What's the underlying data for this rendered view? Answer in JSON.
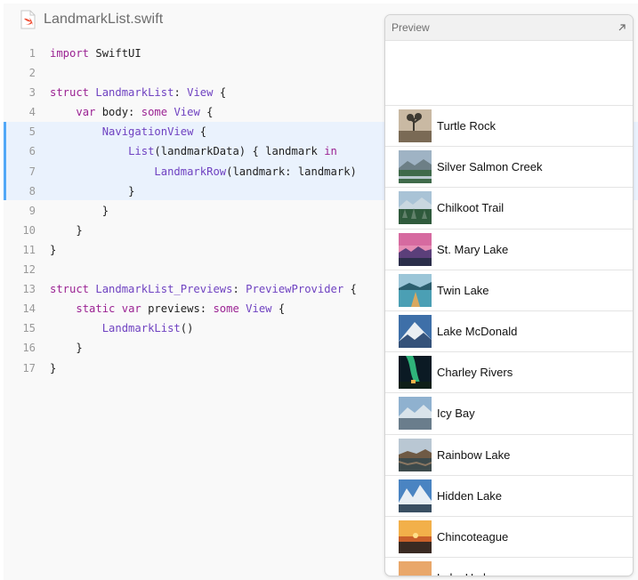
{
  "file": {
    "title": "LandmarkList.swift",
    "icon": "swift-file-icon"
  },
  "code": {
    "highlighted_lines": [
      5,
      6,
      7,
      8
    ],
    "lines": [
      {
        "n": "1",
        "indent": 0,
        "tokens": [
          {
            "t": "kw",
            "v": "import"
          },
          {
            "t": "tx",
            "v": " SwiftUI"
          }
        ]
      },
      {
        "n": "2",
        "indent": 0,
        "tokens": []
      },
      {
        "n": "3",
        "indent": 0,
        "tokens": [
          {
            "t": "kw",
            "v": "struct"
          },
          {
            "t": "tx",
            "v": " "
          },
          {
            "t": "ty",
            "v": "LandmarkList"
          },
          {
            "t": "tx",
            "v": ": "
          },
          {
            "t": "ty",
            "v": "View"
          },
          {
            "t": "tx",
            "v": " {"
          }
        ]
      },
      {
        "n": "4",
        "indent": 1,
        "tokens": [
          {
            "t": "kw",
            "v": "var"
          },
          {
            "t": "tx",
            "v": " body: "
          },
          {
            "t": "kw",
            "v": "some"
          },
          {
            "t": "tx",
            "v": " "
          },
          {
            "t": "ty",
            "v": "View"
          },
          {
            "t": "tx",
            "v": " {"
          }
        ]
      },
      {
        "n": "5",
        "indent": 2,
        "tokens": [
          {
            "t": "ty",
            "v": "NavigationView"
          },
          {
            "t": "tx",
            "v": " {"
          }
        ]
      },
      {
        "n": "6",
        "indent": 3,
        "tokens": [
          {
            "t": "ty",
            "v": "List"
          },
          {
            "t": "tx",
            "v": "(landmarkData) { landmark "
          },
          {
            "t": "kw",
            "v": "in"
          }
        ]
      },
      {
        "n": "7",
        "indent": 4,
        "tokens": [
          {
            "t": "ty",
            "v": "LandmarkRow"
          },
          {
            "t": "tx",
            "v": "(landmark: landmark)"
          }
        ]
      },
      {
        "n": "8",
        "indent": 3,
        "tokens": [
          {
            "t": "tx",
            "v": "}"
          }
        ]
      },
      {
        "n": "9",
        "indent": 2,
        "tokens": [
          {
            "t": "tx",
            "v": "}"
          }
        ]
      },
      {
        "n": "10",
        "indent": 1,
        "tokens": [
          {
            "t": "tx",
            "v": "}"
          }
        ]
      },
      {
        "n": "11",
        "indent": 0,
        "tokens": [
          {
            "t": "tx",
            "v": "}"
          }
        ]
      },
      {
        "n": "12",
        "indent": 0,
        "tokens": []
      },
      {
        "n": "13",
        "indent": 0,
        "tokens": [
          {
            "t": "kw",
            "v": "struct"
          },
          {
            "t": "tx",
            "v": " "
          },
          {
            "t": "ty",
            "v": "LandmarkList_Previews"
          },
          {
            "t": "tx",
            "v": ": "
          },
          {
            "t": "ty",
            "v": "PreviewProvider"
          },
          {
            "t": "tx",
            "v": " {"
          }
        ]
      },
      {
        "n": "14",
        "indent": 1,
        "tokens": [
          {
            "t": "kw",
            "v": "static"
          },
          {
            "t": "tx",
            "v": " "
          },
          {
            "t": "kw",
            "v": "var"
          },
          {
            "t": "tx",
            "v": " previews: "
          },
          {
            "t": "kw",
            "v": "some"
          },
          {
            "t": "tx",
            "v": " "
          },
          {
            "t": "ty",
            "v": "View"
          },
          {
            "t": "tx",
            "v": " {"
          }
        ]
      },
      {
        "n": "15",
        "indent": 2,
        "tokens": [
          {
            "t": "ty",
            "v": "LandmarkList"
          },
          {
            "t": "tx",
            "v": "()"
          }
        ]
      },
      {
        "n": "16",
        "indent": 1,
        "tokens": [
          {
            "t": "tx",
            "v": "}"
          }
        ]
      },
      {
        "n": "17",
        "indent": 0,
        "tokens": [
          {
            "t": "tx",
            "v": "}"
          }
        ]
      }
    ]
  },
  "preview": {
    "title": "Preview",
    "expand_icon": "expand-arrow-icon",
    "items": [
      {
        "label": "Turtle Rock",
        "thumb": "desert",
        "palette": [
          "#c9b9a3",
          "#7a6a55",
          "#3e3a32"
        ]
      },
      {
        "label": "Silver Salmon Creek",
        "thumb": "creek",
        "palette": [
          "#9fb3c4",
          "#3f6a4a",
          "#6d7f86"
        ]
      },
      {
        "label": "Chilkoot Trail",
        "thumb": "forest",
        "palette": [
          "#a9c3d6",
          "#2f5a3c",
          "#61806a"
        ]
      },
      {
        "label": "St. Mary Lake",
        "thumb": "sunset",
        "palette": [
          "#d66aa0",
          "#5b3f7a",
          "#2b2e4a"
        ]
      },
      {
        "label": "Twin Lake",
        "thumb": "lake",
        "palette": [
          "#9cc6d8",
          "#4b9fb4",
          "#2c5f6f"
        ]
      },
      {
        "label": "Lake McDonald",
        "thumb": "mountain",
        "palette": [
          "#3e6fa8",
          "#e9eef3",
          "#35527a"
        ]
      },
      {
        "label": "Charley Rivers",
        "thumb": "aurora",
        "palette": [
          "#0b1a24",
          "#2fb37a",
          "#4d3a22"
        ]
      },
      {
        "label": "Icy Bay",
        "thumb": "icy",
        "palette": [
          "#8fb1cf",
          "#d9e3ea",
          "#6a7d8c"
        ]
      },
      {
        "label": "Rainbow Lake",
        "thumb": "rainbow",
        "palette": [
          "#b9c7d3",
          "#6f5a45",
          "#3d4a4c"
        ]
      },
      {
        "label": "Hidden Lake",
        "thumb": "hidden",
        "palette": [
          "#4a84c2",
          "#e8eef4",
          "#3a4f62"
        ]
      },
      {
        "label": "Chincoteague",
        "thumb": "dusk",
        "palette": [
          "#f2b04a",
          "#c9602a",
          "#3a2a22"
        ]
      },
      {
        "label": "Lake Umbagog",
        "thumb": "partial",
        "palette": [
          "#e9a76a",
          "#c98a5a",
          "#6b5a4a"
        ]
      }
    ]
  },
  "colors": {
    "keyword": "#9b2393",
    "type": "#6f42c1",
    "highlight": "#eaf2fd",
    "highlight_bar": "#52a8f7"
  }
}
